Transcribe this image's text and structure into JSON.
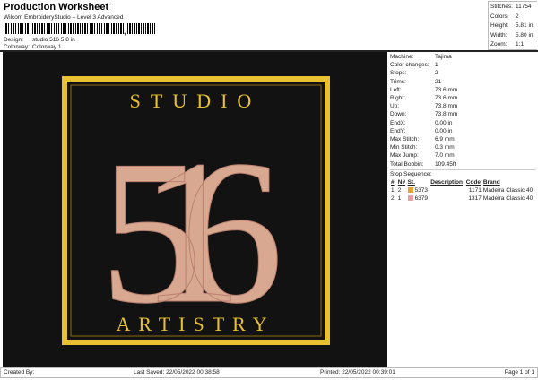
{
  "header": {
    "title": "Production Worksheet",
    "subtitle": "Wilcom EmbroideryStudio – Level 3 Advanced",
    "design_label": "Design:",
    "design_value": "studio 516 5,8 in",
    "colorway_label": "Colorway:",
    "colorway_value": "Colorway 1"
  },
  "stats": [
    {
      "label": "Stitches:",
      "value": "11754"
    },
    {
      "label": "Colors:",
      "value": "2"
    },
    {
      "label": "Height:",
      "value": "5.81 in"
    },
    {
      "label": "Width:",
      "value": "5.80 in"
    },
    {
      "label": "Zoom:",
      "value": "1:1"
    }
  ],
  "design": {
    "top_text": "STUDIO",
    "number": "516",
    "bottom_text": "ARTISTRY",
    "frame_color": "#e8c030",
    "thread_color": "#d9a890",
    "background": "#121212"
  },
  "details": [
    {
      "label": "Machine:",
      "value": "Tajima"
    },
    {
      "label": "Color changes:",
      "value": "1"
    },
    {
      "label": "Stops:",
      "value": "2"
    },
    {
      "label": "Trims:",
      "value": "21"
    },
    {
      "label": "Left:",
      "value": "73.6 mm"
    },
    {
      "label": "Right:",
      "value": "73.6 mm"
    },
    {
      "label": "Up:",
      "value": "73.8 mm"
    },
    {
      "label": "Down:",
      "value": "73.8 mm"
    },
    {
      "label": "EndX:",
      "value": "0.00 in"
    },
    {
      "label": "EndY:",
      "value": "0.00 in"
    },
    {
      "label": "Max Stitch:",
      "value": "6.9 mm"
    },
    {
      "label": "Min Stitch:",
      "value": "0.3 mm"
    },
    {
      "label": "Max Jump:",
      "value": "7.0 mm"
    },
    {
      "label": "Total Bobbin:",
      "value": "109.45ft"
    }
  ],
  "stop_sequence": {
    "title": "Stop Sequence:",
    "headers": [
      "#",
      "N#",
      "St.",
      "Description",
      "Code",
      "Brand"
    ],
    "rows": [
      {
        "n": "1.",
        "nn": "2",
        "color": "#e8a030",
        "st": "5373",
        "desc": "",
        "code": "1171",
        "brand": "Madeira Classic 40"
      },
      {
        "n": "2.",
        "nn": "1",
        "color": "#e8a0a0",
        "st": "6379",
        "desc": "",
        "code": "1317",
        "brand": "Madeira Classic 40"
      }
    ]
  },
  "footer": {
    "created": "Created By:",
    "saved": "Last Saved: 22/05/2022 00:38:58",
    "printed": "Printed: 22/05/2022 00:39:01",
    "page": "Page 1 of 1"
  }
}
